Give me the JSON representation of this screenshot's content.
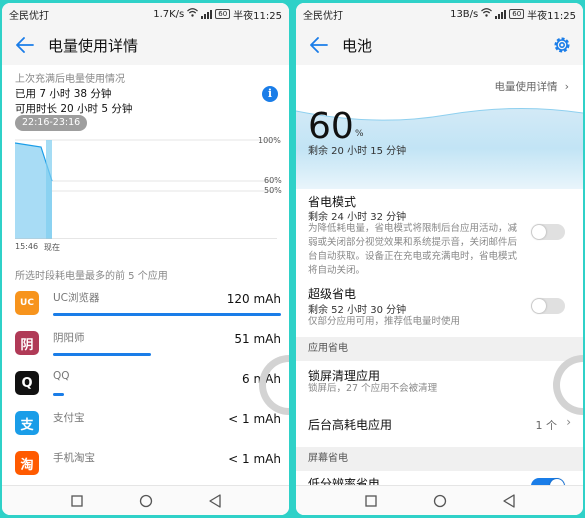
{
  "status_left": {
    "carrier": "全民优打",
    "speed": "1.7K/s",
    "battery": "60",
    "time": "半夜11:25"
  },
  "status_right": {
    "carrier": "全民优打",
    "speed": "13B/s",
    "battery": "60",
    "time": "半夜11:25"
  },
  "left": {
    "title": "电量使用详情",
    "since_label": "上次充满后电量使用情况",
    "used": "已用 7 小时 38 分钟",
    "available": "可用时长 20 小时 5 分钟",
    "time_range": "22:16-23:16",
    "info_glyph": "i",
    "chart": {
      "y_ticks": [
        "100%",
        "60%",
        "50%"
      ],
      "x_labels": [
        "15:46",
        "现在"
      ]
    },
    "section_header": "所选时段耗电量最多的前 5 个应用",
    "apps": [
      {
        "name": "UC浏览器",
        "value": "120 mAh",
        "fraction": 1.0,
        "icon": "uc-browser-icon",
        "color": "#f7941d",
        "glyph": "UC"
      },
      {
        "name": "阴阳师",
        "value": "51 mAh",
        "fraction": 0.43,
        "icon": "onmyoji-icon",
        "color": "#b03a57",
        "glyph": "阴"
      },
      {
        "name": "QQ",
        "value": "6 mAh",
        "fraction": 0.05,
        "icon": "qq-icon",
        "color": "#111111",
        "glyph": "Q"
      },
      {
        "name": "支付宝",
        "value": "< 1 mAh",
        "fraction": 0.0,
        "icon": "alipay-icon",
        "color": "#1a9de8",
        "glyph": "支"
      },
      {
        "name": "手机淘宝",
        "value": "< 1 mAh",
        "fraction": 0.0,
        "icon": "taobao-icon",
        "color": "#ff5a00",
        "glyph": "淘"
      }
    ]
  },
  "right": {
    "title": "电池",
    "detail_link": "电量使用详情",
    "percent": "60",
    "percent_sign": "%",
    "remaining": "剩余 20 小时 15 分钟",
    "power_saving": {
      "title": "省电模式",
      "sub": "剩余 24 小时 32 分钟",
      "desc": "为降低耗电量，省电模式将限制后台应用活动，减弱或关闭部分视觉效果和系统提示音，关闭邮件后台自动获取。设备正在充电或充满电时，省电模式将自动关闭。",
      "enabled": false
    },
    "ultra_saving": {
      "title": "超级省电",
      "sub": "剩余 52 小时 30 分钟",
      "desc": "仅部分应用可用，推荐低电量时使用",
      "enabled": false
    },
    "app_saving_header": "应用省电",
    "lockscreen": {
      "title": "锁屏清理应用",
      "desc": "锁屏后，27 个应用不会被清理"
    },
    "high_drain": {
      "title": "后台高耗电应用",
      "count": "1 个"
    },
    "screen_saving_header": "屏幕省电",
    "low_res": {
      "title": "低分辨率省电",
      "enabled": true
    }
  }
}
